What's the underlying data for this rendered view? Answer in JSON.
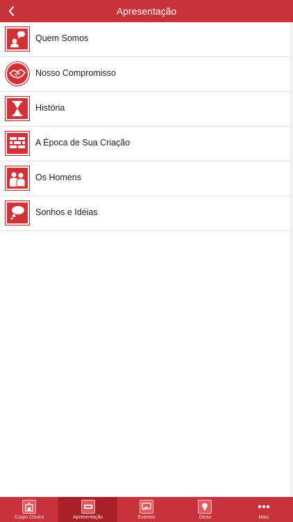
{
  "header": {
    "title": "Apresentação",
    "back_icon": "chevron-left-icon"
  },
  "menu": {
    "items": [
      {
        "label": "Quem Somos",
        "icon": "person-speech-bubble-icon"
      },
      {
        "label": "Nosso Compromisso",
        "icon": "handshake-icon"
      },
      {
        "label": "História",
        "icon": "hourglass-icon"
      },
      {
        "label": "A Época de Sua Criação",
        "icon": "brick-wall-icon"
      },
      {
        "label": "Os Homens",
        "icon": "doctors-icon"
      },
      {
        "label": "Sonhos e Idéias",
        "icon": "thought-cloud-icon"
      }
    ]
  },
  "tabbar": {
    "tabs": [
      {
        "label": "Corpo Clínico",
        "icon": "clinic-building-icon",
        "active": false
      },
      {
        "label": "Apresentação",
        "icon": "presentation-icon",
        "active": true
      },
      {
        "label": "Exames",
        "icon": "exam-icon",
        "active": false
      },
      {
        "label": "Dicas",
        "icon": "tips-lightbulb-icon",
        "active": false
      },
      {
        "label": "Mais",
        "icon": "more-dots-icon",
        "active": false
      }
    ]
  },
  "colors": {
    "brand_red": "#c8323a",
    "active_tab": "#a82129",
    "icon_red": "#d13238"
  }
}
